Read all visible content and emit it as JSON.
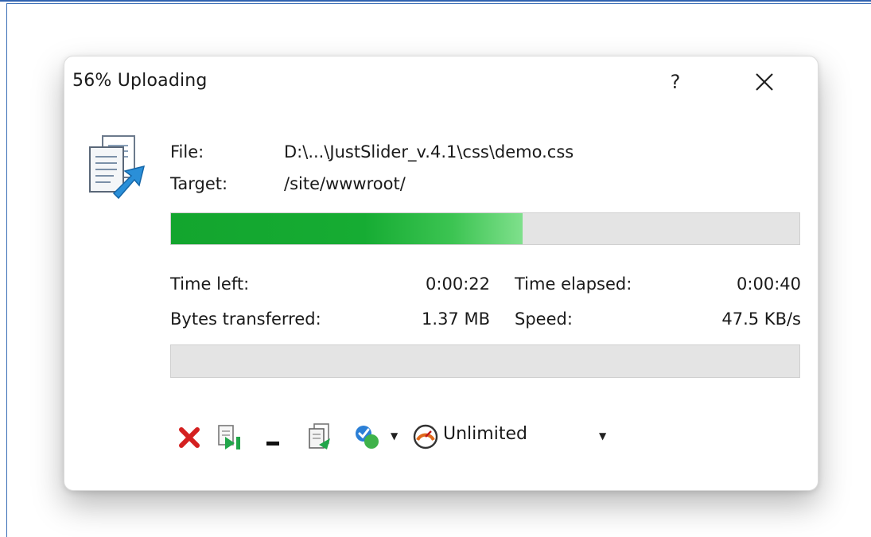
{
  "dialog": {
    "title": "56% Uploading",
    "help_label": "?",
    "close_icon": "close-x-icon"
  },
  "transfer": {
    "file_label": "File:",
    "file_value": "D:\\...\\JustSlider_v.4.1\\css\\demo.css",
    "target_label": "Target:",
    "target_value": "/site/wwwroot/",
    "file_progress": 0.56,
    "total_progress": 0.0
  },
  "stats": {
    "time_left_label": "Time left:",
    "time_left_value": "0:00:22",
    "time_elapsed_label": "Time elapsed:",
    "time_elapsed_value": "0:00:40",
    "bytes_label": "Bytes transferred:",
    "bytes_value": "1.37 MB",
    "speed_label": "Speed:",
    "speed_value": "47.5 KB/s"
  },
  "toolbar": {
    "icons": [
      "cancel-icon",
      "skip-file-icon",
      "minimize-icon",
      "background-transfer-icon",
      "postpone-check-icon",
      "speed-gauge-icon"
    ],
    "speed_limit_label": "Unlimited"
  },
  "colors": {
    "progress": "#16ac33",
    "cancel": "#d42020",
    "frame": "#2f62b0"
  }
}
